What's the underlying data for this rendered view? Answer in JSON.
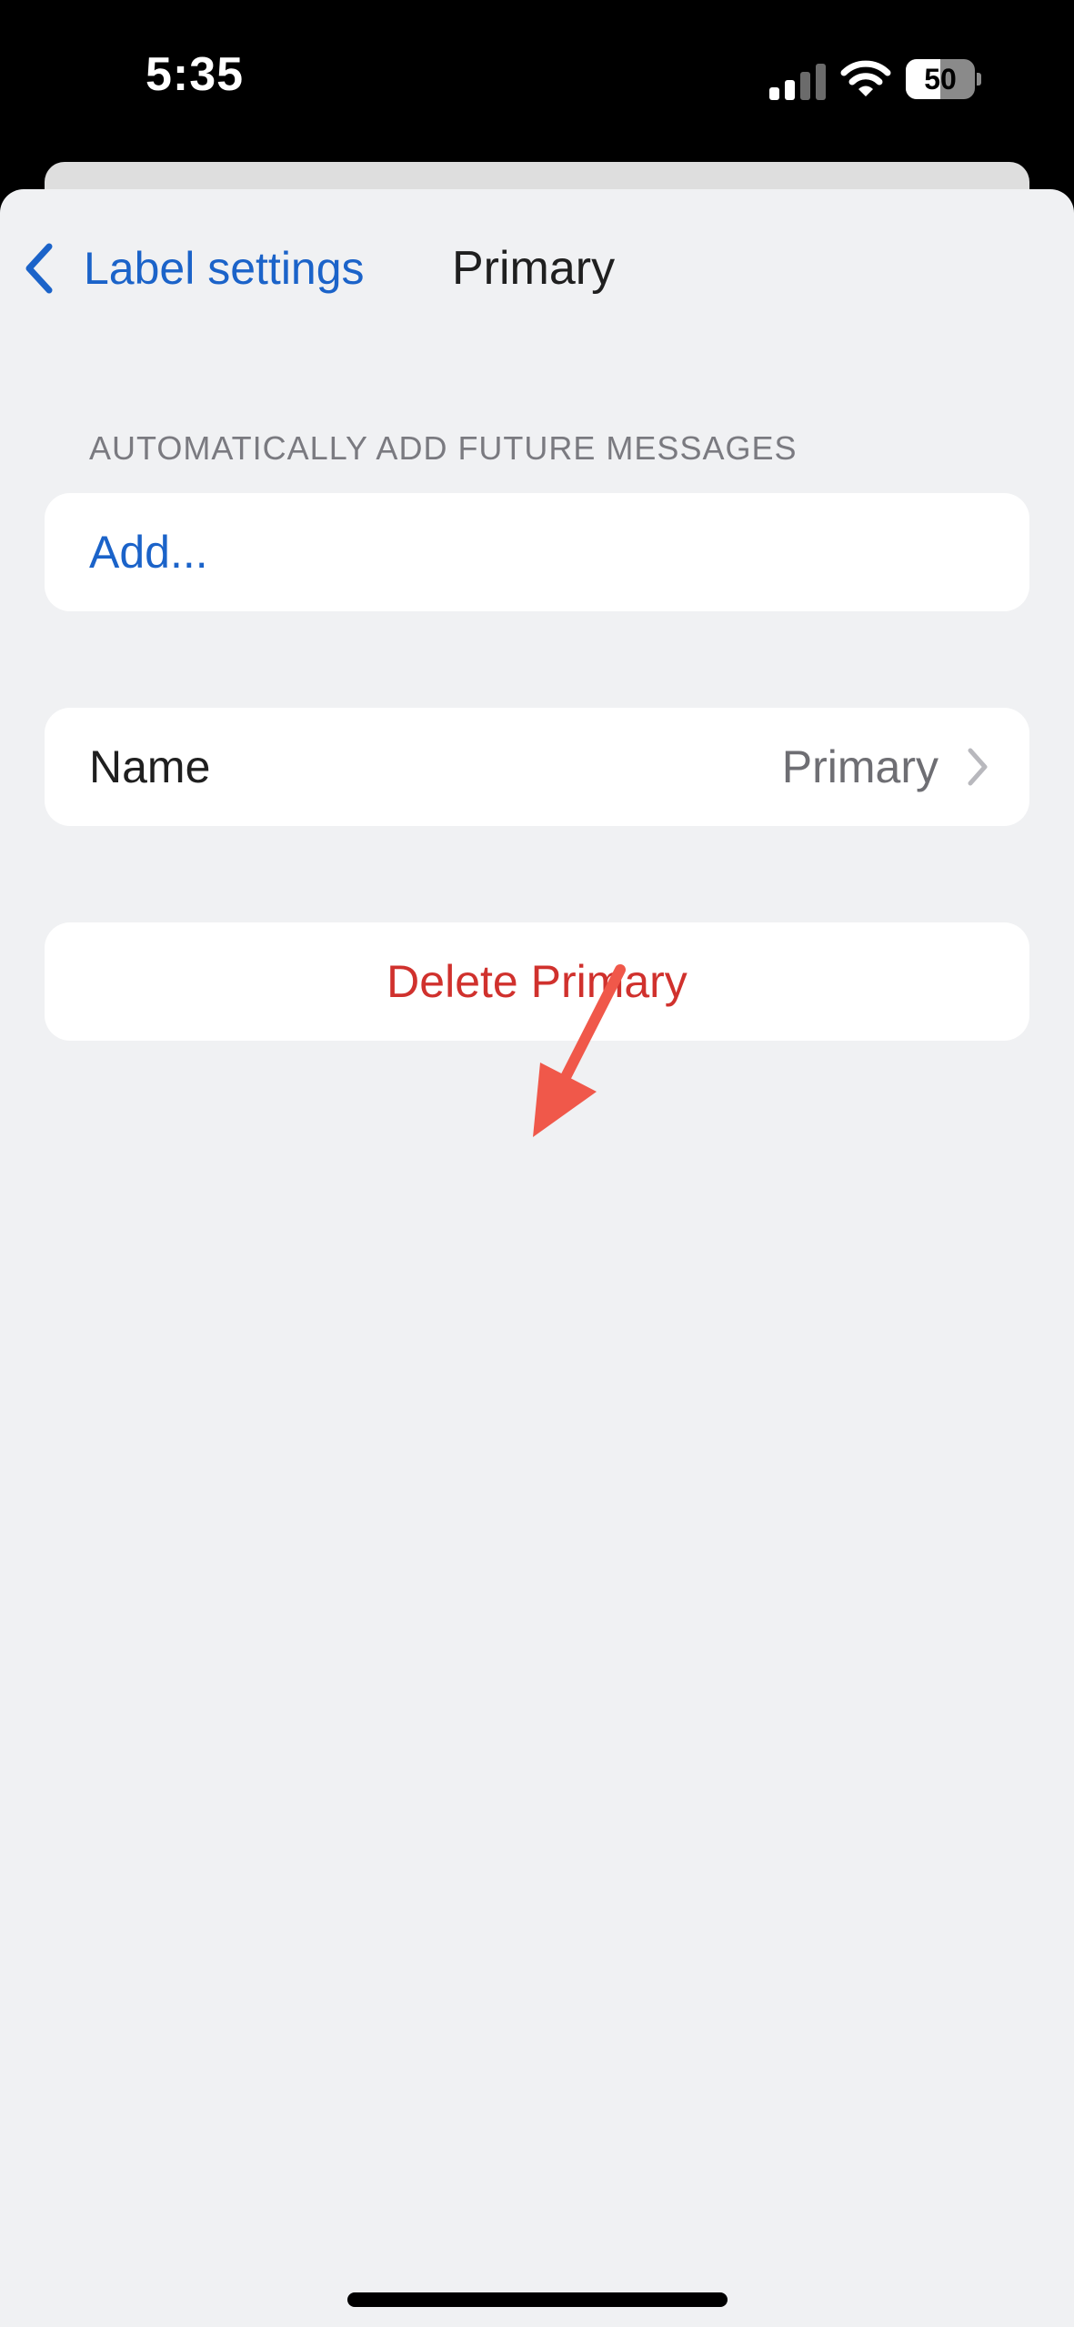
{
  "status_bar": {
    "time": "5:35",
    "battery_level": "50",
    "battery_fraction": 0.5,
    "icons": [
      "cell-signal-icon",
      "wifi-icon",
      "battery-icon"
    ]
  },
  "nav": {
    "back_label": "Label settings",
    "back_icon": "chevron-left-icon",
    "title": "Primary"
  },
  "sections": {
    "auto_add": {
      "header": "AUTOMATICALLY ADD FUTURE MESSAGES",
      "add_label": "Add..."
    },
    "name_row": {
      "label": "Name",
      "value": "Primary",
      "icon": "chevron-right-icon"
    },
    "delete": {
      "label": "Delete Primary"
    }
  },
  "colors": {
    "accent": "#1b63c9",
    "destructive": "#d0312d",
    "background": "#f0f1f3",
    "annotation_arrow": "#f0584a"
  }
}
